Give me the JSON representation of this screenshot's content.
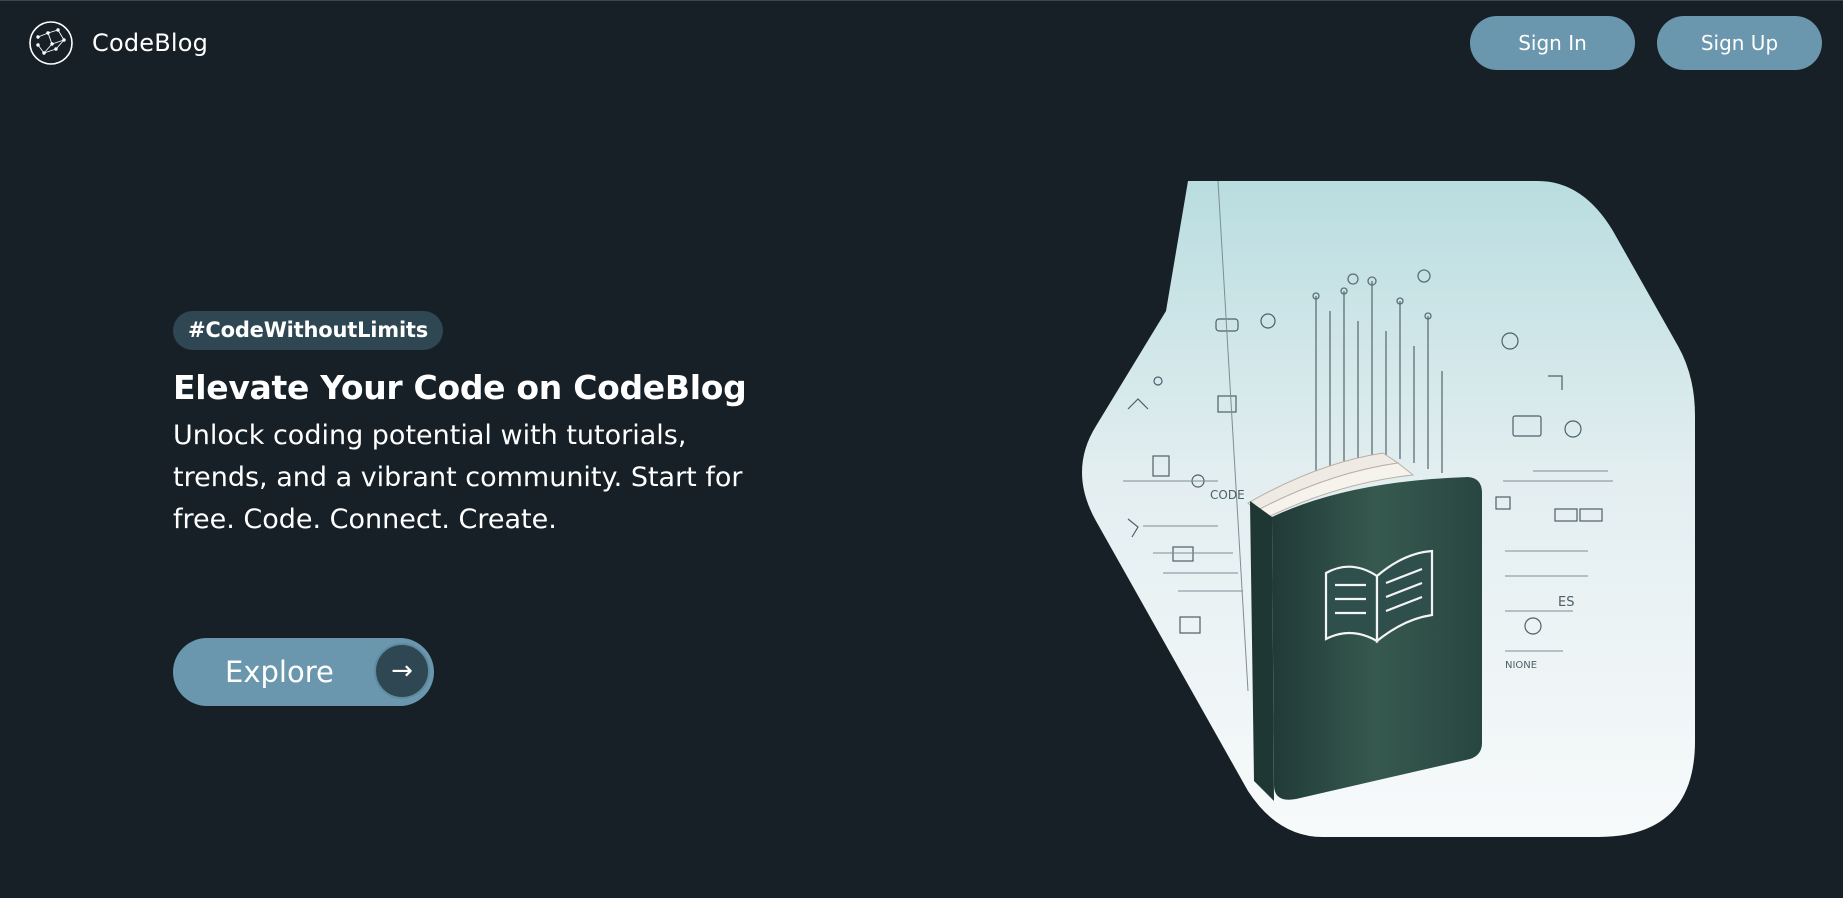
{
  "header": {
    "brand_name": "CodeBlog",
    "logo_icon": "constellation-globe-icon",
    "sign_in_label": "Sign In",
    "sign_up_label": "Sign Up"
  },
  "hero": {
    "tag": "#CodeWithoutLimits",
    "headline": "Elevate Your Code on CodeBlog",
    "subline": "Unlock coding potential with tutorials, trends, and a vibrant community. Start for free. Code. Connect. Create.",
    "explore_label": "Explore",
    "explore_icon": "→",
    "image_subject": "book-with-code-icons-illustration",
    "image_text": {
      "code": "CODE",
      "es": "ES",
      "nione": "NIONE"
    }
  },
  "colors": {
    "background": "#172027",
    "accent": "#6a97ad",
    "tag_background": "#2f4653",
    "book": "#2e4f4b"
  }
}
